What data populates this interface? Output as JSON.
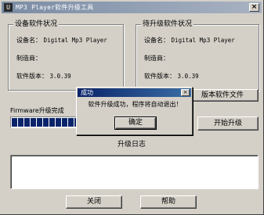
{
  "window": {
    "title": "MP3 Player软件升级工具",
    "app_icon_glyph": "U",
    "close_glyph": "×"
  },
  "device_group": {
    "legend": "设备软件状况",
    "device_name_label": "设备名：",
    "device_name_value": "Digital Mp3 Player",
    "manufacturer_label": "制造商：",
    "version_label": "软件版本：",
    "version_value": "3.0.39"
  },
  "upgrade_group": {
    "legend": "待升级软件状况",
    "device_name_label": "设备名：",
    "device_name_value": "Digital Mp3 Player",
    "manufacturer_label": "制造商：",
    "version_label": "软件版本：",
    "version_value": "3.0.39",
    "select_file_button": "版本软件文件"
  },
  "firmware": {
    "status_label": "Firmware升级完成",
    "progress_segments": 11,
    "progress_fraction": 0.95,
    "start_upgrade_button": "开始升级"
  },
  "log": {
    "title": "升级日志"
  },
  "footer": {
    "close_button": "关闭",
    "help_button": "帮助"
  },
  "dialog": {
    "title": "成功",
    "message": "软件升级成功，程序将自动退出！",
    "ok_button": "确定",
    "close_glyph": "×"
  }
}
